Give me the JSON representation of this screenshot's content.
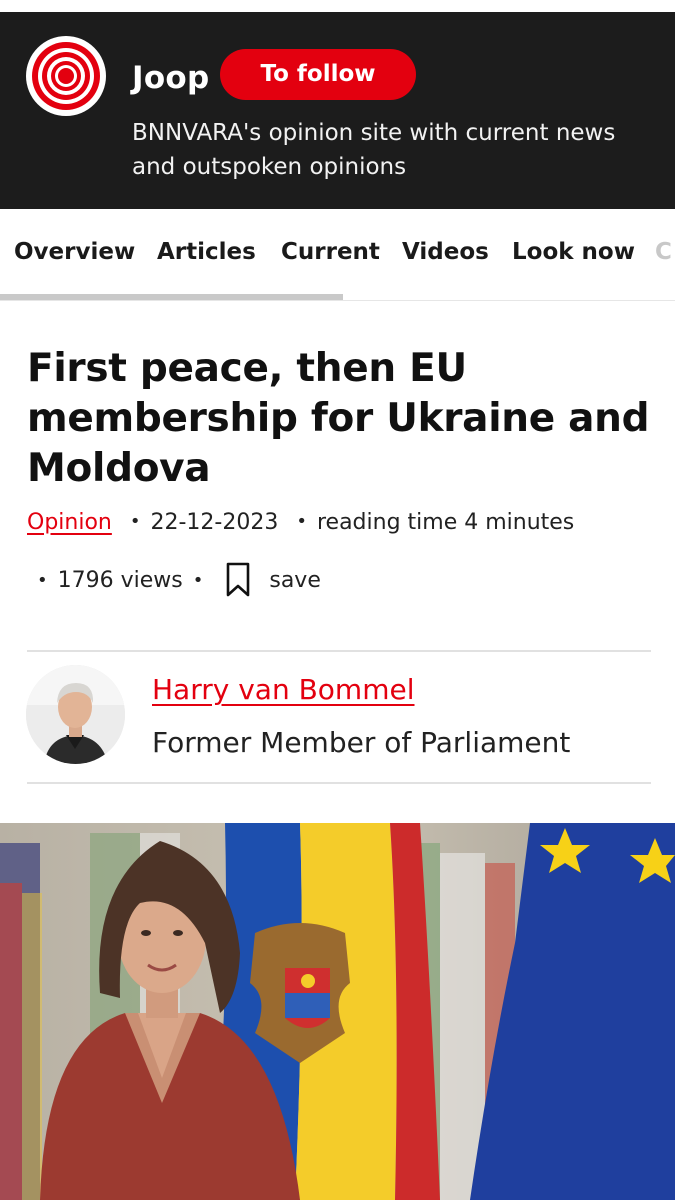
{
  "header": {
    "brand_name": "Joop",
    "follow_label": "To follow",
    "tagline": "BNNVARA's opinion site with current news and outspoken opinions",
    "logo_icon": "joop-target-logo",
    "colors": {
      "header_bg": "#1c1c1c",
      "accent": "#e3000f"
    }
  },
  "tabs": {
    "items": [
      "Overview",
      "Articles",
      "Current",
      "Videos",
      "Look now"
    ],
    "overflow_label": "C",
    "active": "Overview"
  },
  "article": {
    "title": "First peace, then EU membership for Ukraine and Moldova",
    "category": "Opinion",
    "date": "22-12-2023",
    "reading_time": "reading time 4 minutes",
    "views": "1796 views",
    "save_label": "save",
    "bookmark_icon": "bookmark-icon"
  },
  "author": {
    "name": "Harry van Bommel",
    "role": "Former Member of Parliament"
  },
  "hero": {
    "subject": "photo"
  }
}
